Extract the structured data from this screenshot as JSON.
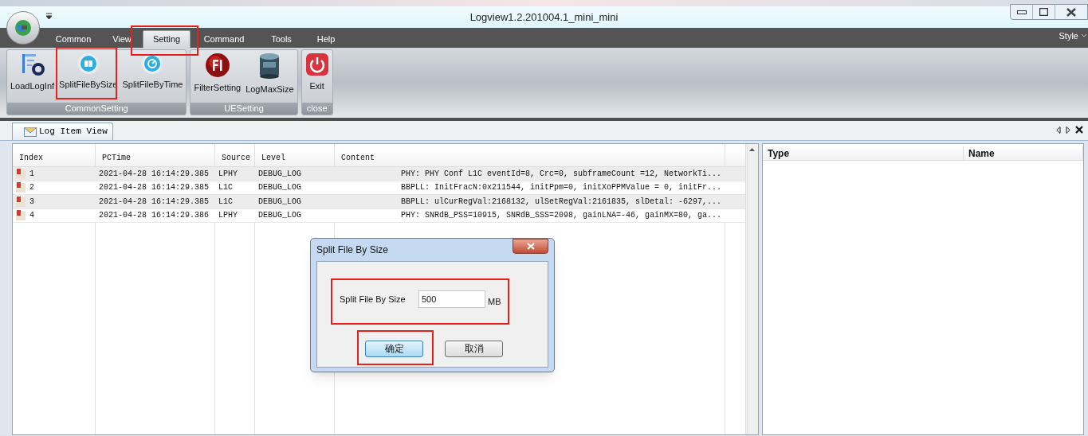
{
  "window": {
    "title": "Logview1.2.201004.1_mini_mini"
  },
  "menu_tabs": [
    {
      "label": "Common",
      "selected": false,
      "highlighted": false
    },
    {
      "label": "View",
      "selected": false,
      "highlighted": false
    },
    {
      "label": "Setting",
      "selected": true,
      "highlighted": true
    },
    {
      "label": "Command",
      "selected": false,
      "highlighted": false
    },
    {
      "label": "Tools",
      "selected": false,
      "highlighted": false
    },
    {
      "label": "Help",
      "selected": false,
      "highlighted": false
    }
  ],
  "style_menu": "Style",
  "ribbon_groups": [
    {
      "label": "CommonSetting",
      "buttons": [
        {
          "label": "LoadLogInf",
          "kind": "loadinfo",
          "highlighted": false
        },
        {
          "label": "SplitFileBySize",
          "kind": "splitsize",
          "highlighted": true
        },
        {
          "label": "SplitFileByTime",
          "kind": "splittime",
          "highlighted": false
        }
      ]
    },
    {
      "label": "UESetting",
      "buttons": [
        {
          "label": "FilterSetting",
          "kind": "filter",
          "highlighted": false
        },
        {
          "label": "LogMaxSize",
          "kind": "maxsize",
          "highlighted": false
        }
      ]
    },
    {
      "label": "close",
      "buttons": [
        {
          "label": "Exit",
          "kind": "power",
          "highlighted": false
        }
      ]
    }
  ],
  "document_tabs": [
    {
      "label": "Log Item View",
      "selected": true
    }
  ],
  "log_table": {
    "columns": [
      "Index",
      "PCTime",
      "Source",
      "Level",
      "Content"
    ],
    "rows": [
      [
        "1",
        "2021-04-28 16:14:29.385",
        "LPHY",
        "DEBUG_LOG",
        "PHY: PHY Conf L1C eventId=8, Crc=0, subframeCount =12, NetworkTi..."
      ],
      [
        "2",
        "2021-04-28 16:14:29.385",
        "L1C",
        "DEBUG_LOG",
        "BBPLL: InitFracN:0x211544, initPpm=0, initXoPPMValue = 0, initFr..."
      ],
      [
        "3",
        "2021-04-28 16:14:29.385",
        "L1C",
        "DEBUG_LOG",
        "BBPLL: ulCurRegVal:2168132, ulSetRegVal:2161835, slDetal: -6297,..."
      ],
      [
        "4",
        "2021-04-28 16:14:29.386",
        "LPHY",
        "DEBUG_LOG",
        "PHY: SNRdB_PSS=10915, SNRdB_SSS=2098, gainLNA=-46, gainMX=80, ga..."
      ]
    ]
  },
  "detail_table": {
    "columns": [
      "Type",
      "Name"
    ]
  },
  "dialog": {
    "title": "Split File By Size",
    "label": "Split File By Size",
    "value": "500",
    "unit": "MB",
    "field_highlighted": true,
    "buttons": [
      {
        "label": "确定",
        "default": true,
        "highlighted": true
      },
      {
        "label": "取消",
        "default": false,
        "highlighted": false
      }
    ]
  }
}
